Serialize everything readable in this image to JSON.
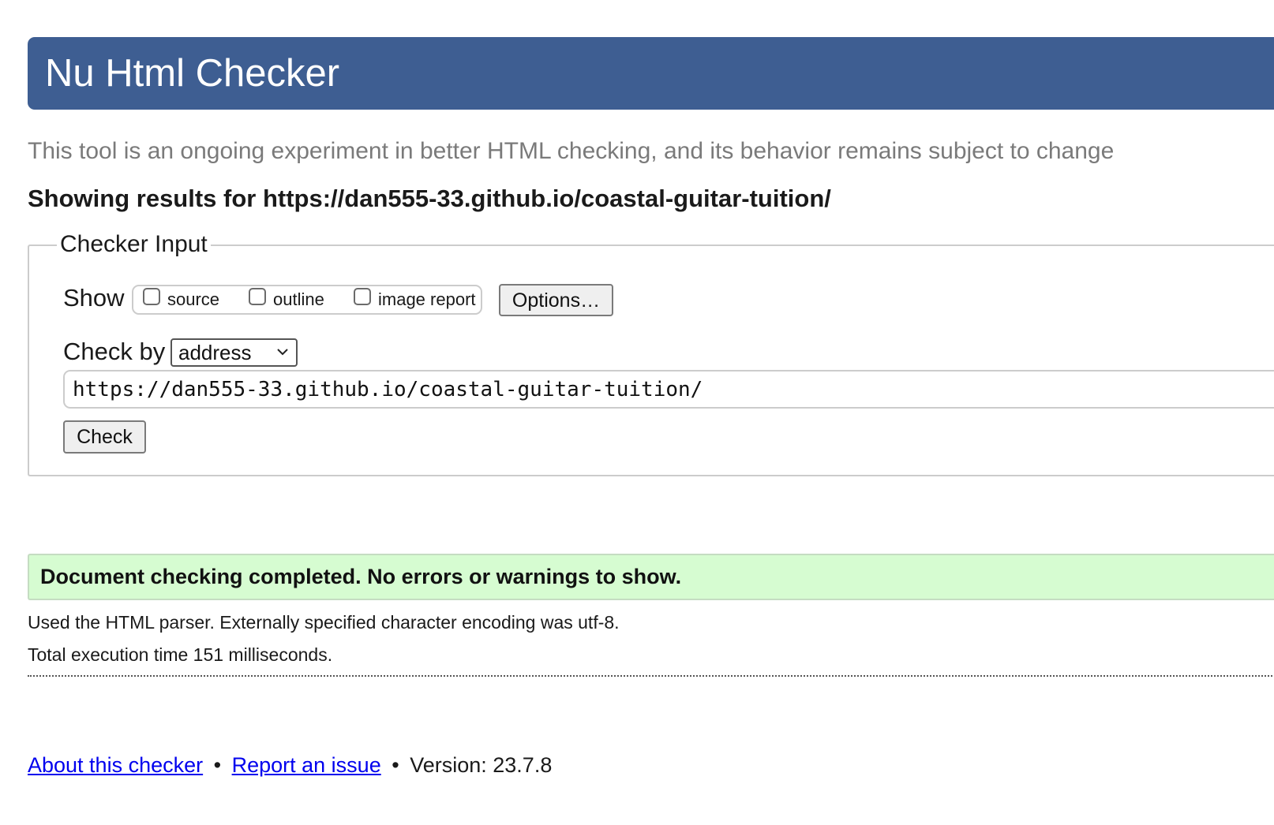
{
  "header": {
    "title": "Nu Html Checker",
    "background_color": "#3e5e92"
  },
  "tagline": "This tool is an ongoing experiment in better HTML checking, and its behavior remains subject to change",
  "results_for": "Showing results for https://dan555-33.github.io/coastal-guitar-tuition/",
  "checker_input": {
    "legend": "Checker Input",
    "show_label": "Show",
    "show_options": [
      {
        "label": "source",
        "checked": false
      },
      {
        "label": "outline",
        "checked": false
      },
      {
        "label": "image report",
        "checked": false
      }
    ],
    "options_button": "Options…",
    "check_by_label": "Check by",
    "check_by_selected": "address",
    "url_value": "https://dan555-33.github.io/coastal-guitar-tuition/",
    "check_button": "Check"
  },
  "result": {
    "message": "Document checking completed. No errors or warnings to show.",
    "background_color": "#d6fcd1",
    "parser_info": "Used the HTML parser. Externally specified character encoding was utf-8.",
    "execution_time": "Total execution time 151 milliseconds."
  },
  "footer": {
    "about_link": "About this checker",
    "separator": "•",
    "report_link": "Report an issue",
    "version": "Version: 23.7.8"
  }
}
